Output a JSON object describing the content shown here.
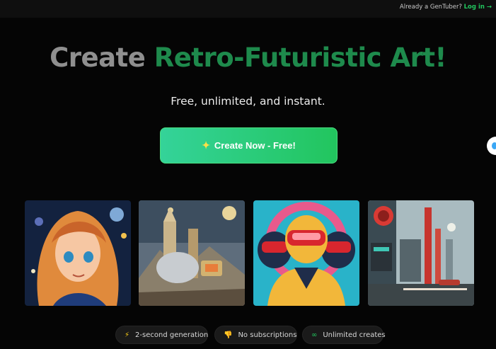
{
  "topbar": {
    "question": "Already a GenTuber?",
    "login_label": "Log in →"
  },
  "hero": {
    "headline_part1": "Create",
    "headline_part2": "Retro-Futuristic Art!",
    "subtitle": "Free, unlimited, and instant.",
    "cta_icon": "sparkles-icon",
    "cta_label": "Create Now - Free!"
  },
  "gallery": [
    {
      "name": "anime-space-girl"
    },
    {
      "name": "retro-alien-city"
    },
    {
      "name": "astronauts-pop-art"
    },
    {
      "name": "futuristic-street"
    }
  ],
  "features": [
    {
      "icon": "lightning-icon",
      "glyph": "⚡",
      "label": "2-second generation"
    },
    {
      "icon": "thumbs-down-icon",
      "glyph": "👎",
      "label": "No subscriptions"
    },
    {
      "icon": "infinity-icon",
      "glyph": "∞",
      "label": "Unlimited creates"
    }
  ],
  "colors": {
    "accent": "#22c55e",
    "headline_grey": "#8f8f8f",
    "headline_green": "#1e8a4c",
    "background": "#050505"
  }
}
